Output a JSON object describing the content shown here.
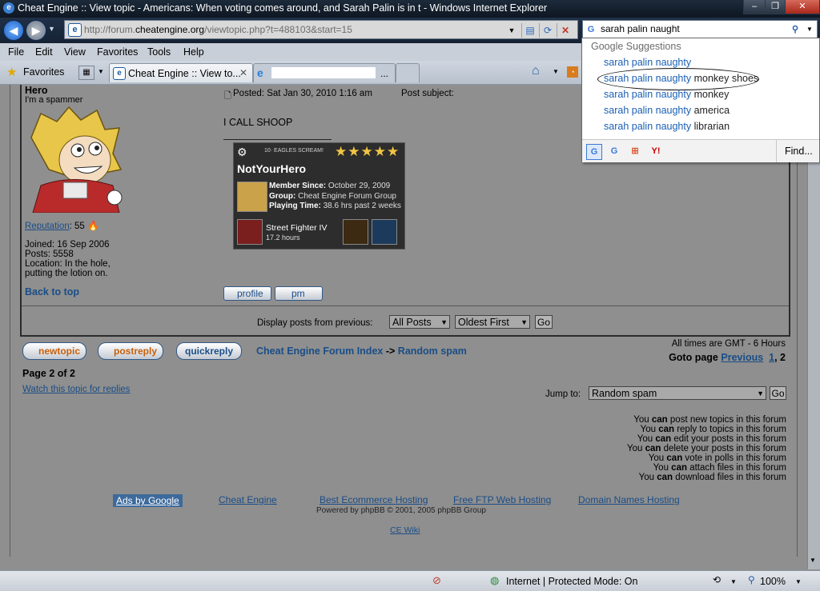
{
  "window": {
    "title": "Cheat Engine :: View topic - Americans: When voting comes around, and Sarah Palin is in t - Windows Internet Explorer",
    "minimize": "–",
    "restore": "❐",
    "close": "✕"
  },
  "address_bar": {
    "url_prefix": "http://forum.",
    "url_domain": "cheatengine.org",
    "url_suffix": "/viewtopic.php?t=488103&start=15"
  },
  "search": {
    "value": "sarah palin naught",
    "suggestions_header": "Google Suggestions",
    "suggestions": [
      {
        "query": "sarah palin naughty",
        "rest": ""
      },
      {
        "query": "sarah palin naughty",
        "rest": " monkey shoes"
      },
      {
        "query": "sarah palin naughty",
        "rest": " monkey"
      },
      {
        "query": "sarah palin naughty",
        "rest": " america"
      },
      {
        "query": "sarah palin naughty",
        "rest": " librarian"
      }
    ],
    "find_label": "Find..."
  },
  "menu": [
    "File",
    "Edit",
    "View",
    "Favorites",
    "Tools",
    "Help"
  ],
  "tabs": {
    "favorites": "Favorites",
    "active_tab": "Cheat Engine :: View to...",
    "second_tab": "..."
  },
  "post": {
    "author": "Hero",
    "rank": "I'm a spammer",
    "reputation_label": "Reputation",
    "reputation_value": ": 55",
    "joined": "Joined: 16 Sep 2006",
    "posts": "Posts: 5558",
    "location_line1": "Location: In the hole,",
    "location_line2": "putting the lotion on.",
    "back_to_top": "Back to top",
    "posted": "Posted: Sat Jan 30, 2010 1:16 am",
    "subject": "Post subject:",
    "body": "I CALL SHOOP",
    "profile_btn": "profile",
    "pm_btn": "pm"
  },
  "steam_card": {
    "tag": "10· EAGLES SCREAM!",
    "name": "NotYourHero",
    "member_since_label": "Member Since:",
    "member_since": "October 29, 2009",
    "group_label": "Group:",
    "group": "Cheat Engine Forum Group",
    "playing_label": "Playing Time:",
    "playing": "38.6 hrs past 2 weeks",
    "game": "Street Fighter IV",
    "game_hours": "17.2 hours",
    "stars": "★★★★★"
  },
  "display_posts": {
    "label": "Display posts from previous:",
    "option1": "All Posts",
    "option2": "Oldest First",
    "go": "Go"
  },
  "nav": {
    "new_topic": "newtopic",
    "post_reply": "postreply",
    "quick_reply": "quickreply",
    "forum_index": "Cheat Engine Forum Index",
    "arrow": "->",
    "random_spam": "Random spam",
    "timezone": "All times are GMT - 6 Hours",
    "goto_label": "Goto page",
    "previous": "Previous",
    "page1": "1",
    "comma": ", 2",
    "page_of": "Page 2 of 2",
    "watch": "Watch this topic for replies",
    "jump_label": "Jump to:",
    "jump_value": "Random spam",
    "go": "Go"
  },
  "permissions": [
    {
      "pre": "You ",
      "can": "can",
      "post": " post new topics in this forum"
    },
    {
      "pre": "You ",
      "can": "can",
      "post": " reply to topics in this forum"
    },
    {
      "pre": "You ",
      "can": "can",
      "post": " edit your posts in this forum"
    },
    {
      "pre": "You ",
      "can": "can",
      "post": " delete your posts in this forum"
    },
    {
      "pre": "You ",
      "can": "can",
      "post": " vote in polls in this forum"
    },
    {
      "pre": "You ",
      "can": "can",
      "post": " attach files in this forum"
    },
    {
      "pre": "You ",
      "can": "can",
      "post": " download files in this forum"
    }
  ],
  "footer": {
    "ads": "Ads by Google",
    "link1": "Cheat Engine",
    "link2": "Best Ecommerce Hosting",
    "link3": "Free FTP Web Hosting",
    "link4": "Domain Names Hosting",
    "powered": "Powered by phpBB © 2001, 2005 phpBB Group",
    "wiki": "CE Wiki"
  },
  "status": {
    "zone": "Internet | Protected Mode: On",
    "zoom": "100%"
  },
  "colors": {
    "link": "#1a4d86",
    "page_bg": "#8f8f8f",
    "suggest_link": "#1a5fb4"
  }
}
